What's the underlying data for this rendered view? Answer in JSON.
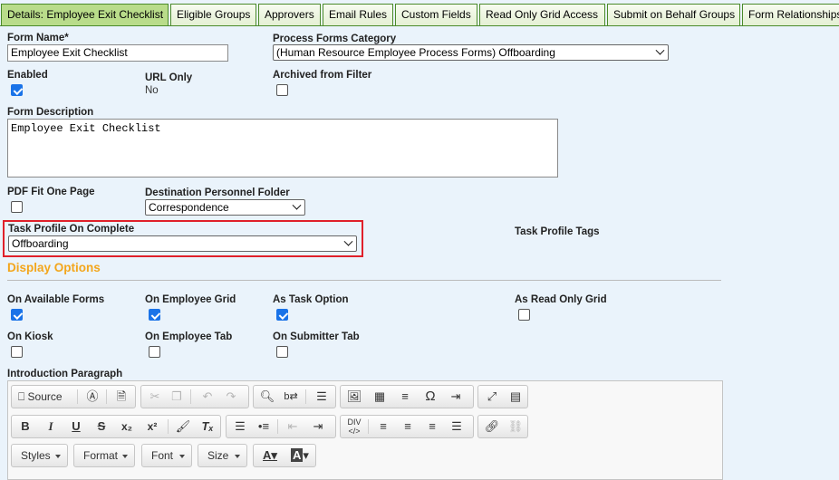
{
  "tabs": [
    {
      "label": "Details: Employee Exit Checklist",
      "active": true
    },
    {
      "label": "Eligible Groups"
    },
    {
      "label": "Approvers"
    },
    {
      "label": "Email Rules"
    },
    {
      "label": "Custom Fields"
    },
    {
      "label": "Read Only Grid Access"
    },
    {
      "label": "Submit on Behalf Groups"
    },
    {
      "label": "Form Relationships"
    }
  ],
  "form": {
    "form_name_label": "Form Name*",
    "form_name_value": "Employee Exit Checklist",
    "category_label": "Process Forms Category",
    "category_value": "(Human Resource Employee Process Forms) Offboarding",
    "enabled_label": "Enabled",
    "enabled": true,
    "url_only_label": "URL Only",
    "url_only_value": "No",
    "archived_label": "Archived from Filter",
    "archived": false,
    "description_label": "Form Description",
    "description_value": "Employee Exit Checklist",
    "pdf_label": "PDF Fit One Page",
    "pdf": false,
    "dest_folder_label": "Destination Personnel Folder",
    "dest_folder_value": "Correspondence",
    "task_profile_label": "Task Profile On Complete",
    "task_profile_value": "Offboarding",
    "task_tags_label": "Task Profile Tags"
  },
  "display_options": {
    "title": "Display Options",
    "on_available_forms_label": "On Available Forms",
    "on_available_forms": true,
    "on_employee_grid_label": "On Employee Grid",
    "on_employee_grid": true,
    "as_task_option_label": "As Task Option",
    "as_task_option": true,
    "as_read_only_grid_label": "As Read Only Grid",
    "as_read_only_grid": false,
    "on_kiosk_label": "On Kiosk",
    "on_kiosk": false,
    "on_employee_tab_label": "On Employee Tab",
    "on_employee_tab": false,
    "on_submitter_tab_label": "On Submitter Tab",
    "on_submitter_tab": false
  },
  "intro": {
    "label": "Introduction Paragraph",
    "source_label": "Source",
    "styles_label": "Styles",
    "format_label": "Format",
    "font_label": "Font",
    "size_label": "Size"
  },
  "colors": {
    "section_title": "#f3a61c",
    "highlight_border": "#e0202a",
    "checkbox_checked": "#1a73e8",
    "tab_active": "#b9dc8a"
  }
}
